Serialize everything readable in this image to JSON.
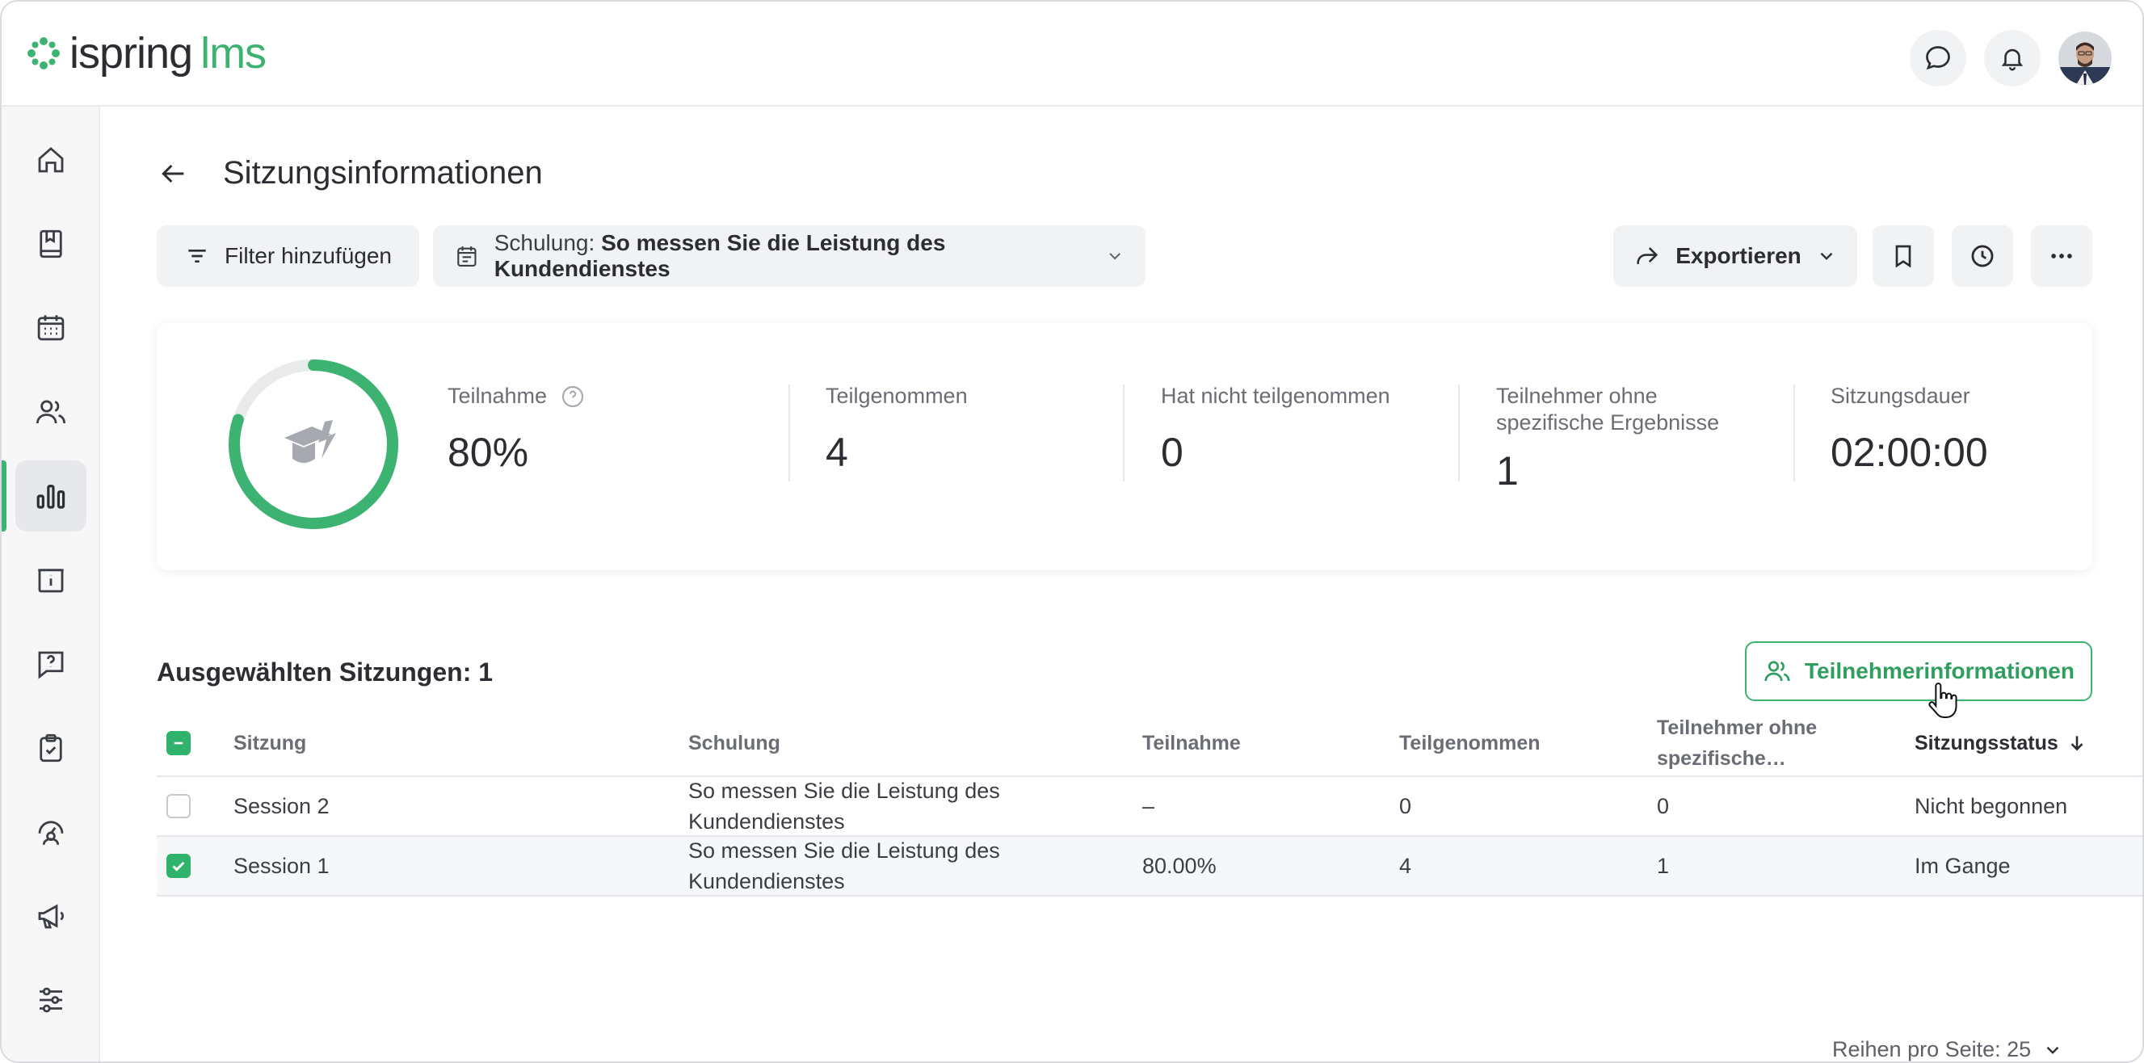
{
  "brand": {
    "name_a": "ispring",
    "name_b": "lms",
    "accent": "#3cb371"
  },
  "topbar": {
    "chat_icon": "chat-bubble-icon",
    "bell_icon": "bell-icon",
    "avatar": "user-avatar"
  },
  "sidebar": {
    "items": [
      {
        "icon": "home-icon"
      },
      {
        "icon": "book-icon"
      },
      {
        "icon": "calendar-icon"
      },
      {
        "icon": "users-icon"
      },
      {
        "icon": "bar-chart-icon",
        "active": true
      },
      {
        "icon": "info-board-icon"
      },
      {
        "icon": "question-icon"
      },
      {
        "icon": "clipboard-check-icon"
      },
      {
        "icon": "user-gauge-icon"
      },
      {
        "icon": "megaphone-icon"
      },
      {
        "icon": "sliders-icon"
      }
    ]
  },
  "header": {
    "title": "Sitzungsinformationen"
  },
  "toolbar": {
    "filter_label": "Filter hinzufügen",
    "training_prefix": "Schulung:",
    "training_value": "So messen Sie die Leistung des Kundendienstes",
    "export_label": "Exportieren"
  },
  "stats": {
    "participation_label": "Teilnahme",
    "participation_value": "80%",
    "participation_fraction": 0.8,
    "attended_label": "Teilgenommen",
    "attended_value": "4",
    "not_attended_label": "Hat nicht teilgenommen",
    "not_attended_value": "0",
    "no_results_label_1": "Teilnehmer ohne",
    "no_results_label_2": "spezifische Ergebnisse",
    "no_results_value": "1",
    "duration_label": "Sitzungsdauer",
    "duration_value": "02:00:00"
  },
  "section": {
    "selected_label": "Ausgewählten Sitzungen: 1",
    "participants_button": "Teilnehmerinformationen"
  },
  "table": {
    "headers": {
      "session": "Sitzung",
      "training": "Schulung",
      "participation": "Teilnahme",
      "attended": "Teilgenommen",
      "no_results_1": "Teilnehmer ohne",
      "no_results_2": "spezifische…",
      "status": "Sitzungsstatus"
    },
    "rows": [
      {
        "session": "Session 2",
        "training_1": "So messen Sie die Leistung des",
        "training_2": "Kundendienstes",
        "participation": "–",
        "attended": "0",
        "no_results": "0",
        "status": "Nicht begonnen",
        "checked": false
      },
      {
        "session": "Session 1",
        "training_1": "So messen Sie die Leistung des",
        "training_2": "Kundendienstes",
        "participation": "80.00%",
        "attended": "4",
        "no_results": "1",
        "status": "Im Gange",
        "checked": true
      }
    ]
  },
  "pagination": {
    "rows_per_page": "Reihen pro Seite: 25"
  }
}
